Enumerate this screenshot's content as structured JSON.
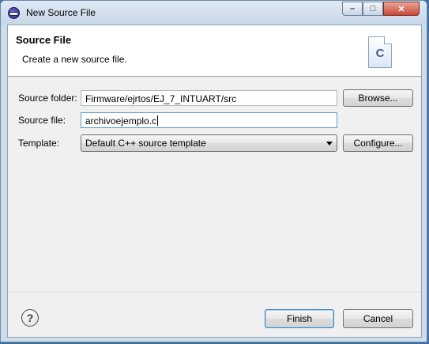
{
  "window": {
    "title": "New Source File",
    "minimize": "–",
    "maximize": "□",
    "close": "✕"
  },
  "header": {
    "title": "Source File",
    "description": "Create a new source file.",
    "icon_letter": "C"
  },
  "form": {
    "source_folder": {
      "label": "Source folder:",
      "value": "Firmware/ejrtos/EJ_7_INTUART/src",
      "button": "Browse..."
    },
    "source_file": {
      "label": "Source file:",
      "value": "archivoejemplo.c"
    },
    "template": {
      "label": "Template:",
      "selected": "Default C++ source template",
      "button": "Configure..."
    }
  },
  "footer": {
    "help_glyph": "?",
    "finish": "Finish",
    "cancel": "Cancel"
  }
}
